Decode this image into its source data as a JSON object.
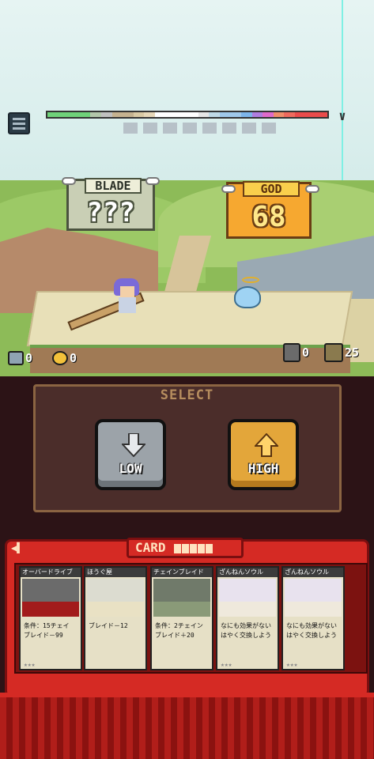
{
  "meter": {
    "rainbow_colors": [
      "#6fd27a",
      "#6fd27a",
      "#6fd27a",
      "#6fd27a",
      "#b3c6aa",
      "#c0c0c0",
      "#c5b290",
      "#c5b290",
      "#d9c9a4",
      "#e6d7b8",
      "#ffffff",
      "#ffffff",
      "#ffffff",
      "#ffffff",
      "#e6e6e6",
      "#bfd9e6",
      "#9fc8ea",
      "#9fc8ea",
      "#7db5ea",
      "#b07de0",
      "#e06acb",
      "#f08d6a",
      "#ef6a5e",
      "#ea4b4b",
      "#ea4b4b",
      "#ea4b4b"
    ],
    "slots": 8
  },
  "signs": {
    "blade": {
      "title": "BLADE",
      "value": "???"
    },
    "god": {
      "title": "GOD",
      "value": "68"
    }
  },
  "inventory": {
    "chain": "0",
    "coin": "0",
    "rock": "0",
    "bag": "25"
  },
  "select": {
    "title": "SELECT",
    "low_label": "LOW",
    "high_label": "HIGH"
  },
  "cards": {
    "title": "CARD",
    "items": [
      {
        "name": "オーバードライブ",
        "desc": "条件：15チェイ\nブレイド－99",
        "stars": "★★★"
      },
      {
        "name": "ほうぐ屋",
        "desc": "ブレイド－12",
        "stars": ""
      },
      {
        "name": "チェインブレイド",
        "desc": "条件：2チェイン\nブレイド＋20",
        "stars": ""
      },
      {
        "name": "ざんねんソウル",
        "desc": "なにも効果がない\nはやく交換しよう",
        "stars": "★★★"
      },
      {
        "name": "ざんねんソウル",
        "desc": "なにも効果がない\nはやく交換しよう",
        "stars": "★★★"
      }
    ]
  }
}
